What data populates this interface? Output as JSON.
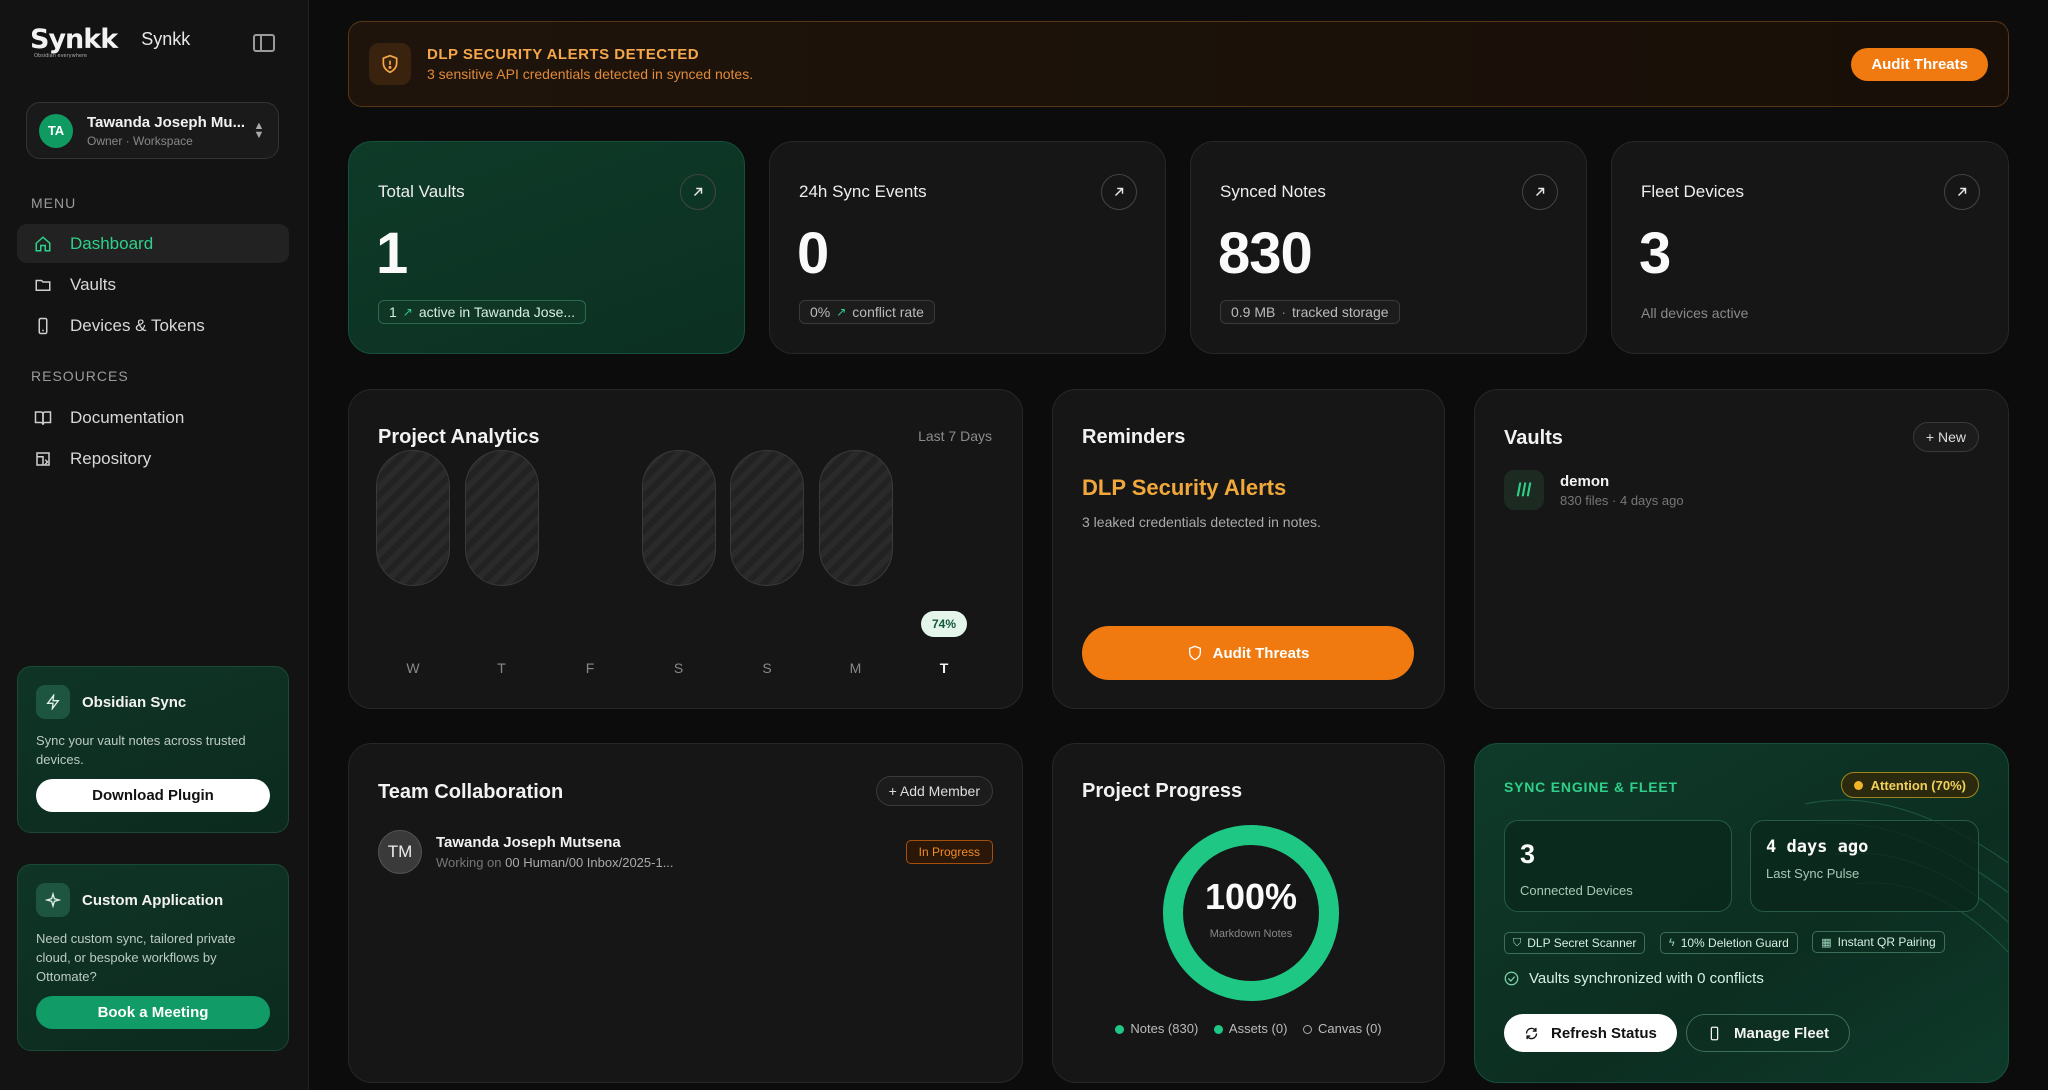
{
  "brand": {
    "logo": "Synkk",
    "tagline": "Obsidian everywhere",
    "name": "Synkk"
  },
  "workspace": {
    "initials": "TA",
    "name": "Tawanda Joseph Mu...",
    "role": "Owner · Workspace"
  },
  "menu": {
    "label": "MENU",
    "items": [
      {
        "label": "Dashboard",
        "icon": "home-icon",
        "active": true
      },
      {
        "label": "Vaults",
        "icon": "folder-icon"
      },
      {
        "label": "Devices & Tokens",
        "icon": "phone-icon"
      }
    ]
  },
  "resources": {
    "label": "RESOURCES",
    "items": [
      {
        "label": "Documentation",
        "icon": "book-icon"
      },
      {
        "label": "Repository",
        "icon": "repo-icon"
      }
    ]
  },
  "promo_sync": {
    "title": "Obsidian Sync",
    "desc": "Sync your vault notes across trusted devices.",
    "button": "Download Plugin"
  },
  "promo_custom": {
    "title": "Custom Application",
    "desc": "Need custom sync, tailored private cloud, or bespoke workflows by Ottomate?",
    "button": "Book a Meeting"
  },
  "alert": {
    "title": "DLP SECURITY ALERTS DETECTED",
    "sub": "3 sensitive API credentials detected in synced notes.",
    "button": "Audit Threats"
  },
  "stats": [
    {
      "label": "Total Vaults",
      "value": "1",
      "pill_prefix": "1",
      "pill_text": "active in Tawanda Jose..."
    },
    {
      "label": "24h Sync Events",
      "value": "0",
      "pill_prefix": "0%",
      "pill_text": "conflict rate"
    },
    {
      "label": "Synced Notes",
      "value": "830",
      "pill_prefix": "0.9 MB",
      "pill_text": "tracked storage"
    },
    {
      "label": "Fleet Devices",
      "value": "3",
      "plain": "All devices active"
    }
  ],
  "analytics": {
    "title": "Project Analytics",
    "range": "Last 7 Days",
    "days": [
      {
        "day": "W",
        "level": 1
      },
      {
        "day": "T",
        "level": 1
      },
      {
        "day": "F",
        "level": 0
      },
      {
        "day": "S",
        "level": 1
      },
      {
        "day": "S",
        "level": 1
      },
      {
        "day": "M",
        "level": 1
      },
      {
        "day": "T",
        "level": 0,
        "today": true,
        "tip": "74%"
      }
    ]
  },
  "reminders": {
    "title": "Reminders",
    "heading": "DLP Security Alerts",
    "text": "3 leaked credentials detected in notes.",
    "button": "Audit Threats"
  },
  "vaults": {
    "title": "Vaults",
    "new_button": "+ New",
    "item_name": "demon",
    "item_meta": "830 files · 4 days ago"
  },
  "team": {
    "title": "Team Collaboration",
    "add_button": "+ Add Member",
    "member_initials": "TM",
    "member_name": "Tawanda Joseph Mutsena",
    "working_prefix": "Working on",
    "working_path": "00 Human/00 Inbox/2025-1...",
    "status": "In Progress"
  },
  "progress": {
    "title": "Project Progress",
    "percent": 100,
    "percent_label": "100%",
    "sublabel": "Markdown Notes",
    "legend": [
      {
        "label": "Notes (830)",
        "color": "#1fc784"
      },
      {
        "label": "Assets (0)",
        "color": "#1fc784"
      },
      {
        "label": "Canvas (0)",
        "color": "#888888"
      }
    ]
  },
  "fleet": {
    "title": "SYNC ENGINE & FLEET",
    "badge": "Attention (70%)",
    "devices_value": "3",
    "devices_label": "Connected Devices",
    "pulse_value": "4 days ago",
    "pulse_label": "Last Sync Pulse",
    "chips": [
      "DLP Secret Scanner",
      "10% Deletion Guard",
      "Instant QR Pairing"
    ],
    "status": "Vaults synchronized with 0 conflicts",
    "refresh_button": "Refresh Status",
    "manage_button": "Manage Fleet"
  }
}
